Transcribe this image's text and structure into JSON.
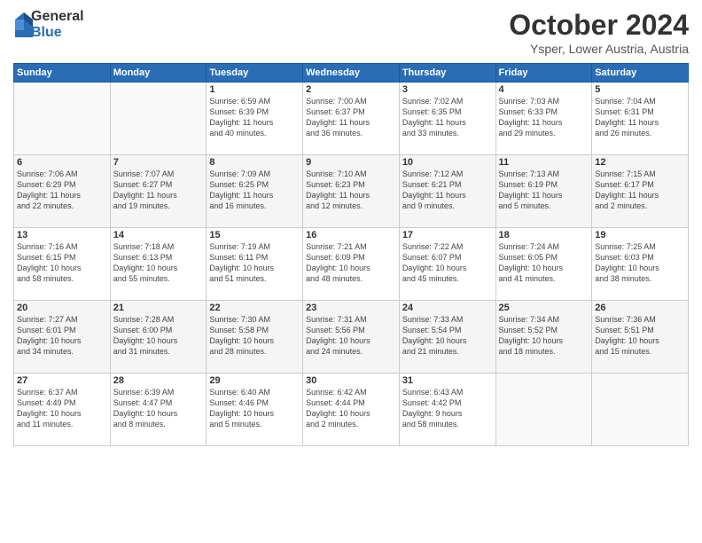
{
  "logo": {
    "general": "General",
    "blue": "Blue"
  },
  "title": "October 2024",
  "location": "Ysper, Lower Austria, Austria",
  "days_of_week": [
    "Sunday",
    "Monday",
    "Tuesday",
    "Wednesday",
    "Thursday",
    "Friday",
    "Saturday"
  ],
  "weeks": [
    [
      {
        "day": "",
        "info": ""
      },
      {
        "day": "",
        "info": ""
      },
      {
        "day": "1",
        "info": "Sunrise: 6:59 AM\nSunset: 6:39 PM\nDaylight: 11 hours\nand 40 minutes."
      },
      {
        "day": "2",
        "info": "Sunrise: 7:00 AM\nSunset: 6:37 PM\nDaylight: 11 hours\nand 36 minutes."
      },
      {
        "day": "3",
        "info": "Sunrise: 7:02 AM\nSunset: 6:35 PM\nDaylight: 11 hours\nand 33 minutes."
      },
      {
        "day": "4",
        "info": "Sunrise: 7:03 AM\nSunset: 6:33 PM\nDaylight: 11 hours\nand 29 minutes."
      },
      {
        "day": "5",
        "info": "Sunrise: 7:04 AM\nSunset: 6:31 PM\nDaylight: 11 hours\nand 26 minutes."
      }
    ],
    [
      {
        "day": "6",
        "info": "Sunrise: 7:06 AM\nSunset: 6:29 PM\nDaylight: 11 hours\nand 22 minutes."
      },
      {
        "day": "7",
        "info": "Sunrise: 7:07 AM\nSunset: 6:27 PM\nDaylight: 11 hours\nand 19 minutes."
      },
      {
        "day": "8",
        "info": "Sunrise: 7:09 AM\nSunset: 6:25 PM\nDaylight: 11 hours\nand 16 minutes."
      },
      {
        "day": "9",
        "info": "Sunrise: 7:10 AM\nSunset: 6:23 PM\nDaylight: 11 hours\nand 12 minutes."
      },
      {
        "day": "10",
        "info": "Sunrise: 7:12 AM\nSunset: 6:21 PM\nDaylight: 11 hours\nand 9 minutes."
      },
      {
        "day": "11",
        "info": "Sunrise: 7:13 AM\nSunset: 6:19 PM\nDaylight: 11 hours\nand 5 minutes."
      },
      {
        "day": "12",
        "info": "Sunrise: 7:15 AM\nSunset: 6:17 PM\nDaylight: 11 hours\nand 2 minutes."
      }
    ],
    [
      {
        "day": "13",
        "info": "Sunrise: 7:16 AM\nSunset: 6:15 PM\nDaylight: 10 hours\nand 58 minutes."
      },
      {
        "day": "14",
        "info": "Sunrise: 7:18 AM\nSunset: 6:13 PM\nDaylight: 10 hours\nand 55 minutes."
      },
      {
        "day": "15",
        "info": "Sunrise: 7:19 AM\nSunset: 6:11 PM\nDaylight: 10 hours\nand 51 minutes."
      },
      {
        "day": "16",
        "info": "Sunrise: 7:21 AM\nSunset: 6:09 PM\nDaylight: 10 hours\nand 48 minutes."
      },
      {
        "day": "17",
        "info": "Sunrise: 7:22 AM\nSunset: 6:07 PM\nDaylight: 10 hours\nand 45 minutes."
      },
      {
        "day": "18",
        "info": "Sunrise: 7:24 AM\nSunset: 6:05 PM\nDaylight: 10 hours\nand 41 minutes."
      },
      {
        "day": "19",
        "info": "Sunrise: 7:25 AM\nSunset: 6:03 PM\nDaylight: 10 hours\nand 38 minutes."
      }
    ],
    [
      {
        "day": "20",
        "info": "Sunrise: 7:27 AM\nSunset: 6:01 PM\nDaylight: 10 hours\nand 34 minutes."
      },
      {
        "day": "21",
        "info": "Sunrise: 7:28 AM\nSunset: 6:00 PM\nDaylight: 10 hours\nand 31 minutes."
      },
      {
        "day": "22",
        "info": "Sunrise: 7:30 AM\nSunset: 5:58 PM\nDaylight: 10 hours\nand 28 minutes."
      },
      {
        "day": "23",
        "info": "Sunrise: 7:31 AM\nSunset: 5:56 PM\nDaylight: 10 hours\nand 24 minutes."
      },
      {
        "day": "24",
        "info": "Sunrise: 7:33 AM\nSunset: 5:54 PM\nDaylight: 10 hours\nand 21 minutes."
      },
      {
        "day": "25",
        "info": "Sunrise: 7:34 AM\nSunset: 5:52 PM\nDaylight: 10 hours\nand 18 minutes."
      },
      {
        "day": "26",
        "info": "Sunrise: 7:36 AM\nSunset: 5:51 PM\nDaylight: 10 hours\nand 15 minutes."
      }
    ],
    [
      {
        "day": "27",
        "info": "Sunrise: 6:37 AM\nSunset: 4:49 PM\nDaylight: 10 hours\nand 11 minutes."
      },
      {
        "day": "28",
        "info": "Sunrise: 6:39 AM\nSunset: 4:47 PM\nDaylight: 10 hours\nand 8 minutes."
      },
      {
        "day": "29",
        "info": "Sunrise: 6:40 AM\nSunset: 4:46 PM\nDaylight: 10 hours\nand 5 minutes."
      },
      {
        "day": "30",
        "info": "Sunrise: 6:42 AM\nSunset: 4:44 PM\nDaylight: 10 hours\nand 2 minutes."
      },
      {
        "day": "31",
        "info": "Sunrise: 6:43 AM\nSunset: 4:42 PM\nDaylight: 9 hours\nand 58 minutes."
      },
      {
        "day": "",
        "info": ""
      },
      {
        "day": "",
        "info": ""
      }
    ]
  ]
}
